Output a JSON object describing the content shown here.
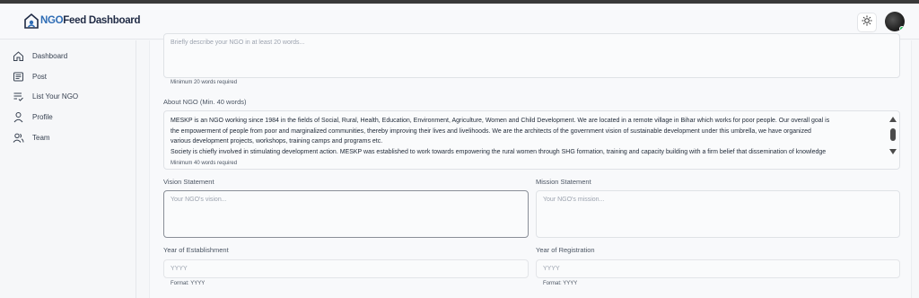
{
  "header": {
    "logo_ngo": "NGO",
    "logo_rest": "Feed Dashboard",
    "theme_icon": "sun-icon",
    "avatar_icon": "user-avatar"
  },
  "sidebar": {
    "items": [
      {
        "label": "Dashboard",
        "icon": "home-icon"
      },
      {
        "label": "Post",
        "icon": "newspaper-icon"
      },
      {
        "label": "List Your NGO",
        "icon": "list-check-icon"
      },
      {
        "label": "Profile",
        "icon": "user-icon"
      },
      {
        "label": "Team",
        "icon": "users-icon"
      }
    ]
  },
  "form": {
    "short_description": {
      "placeholder": "Briefly describe your NGO in at least 20 words...",
      "helper": "Minimum 20 words required"
    },
    "about": {
      "label": "About NGO (Min. 40 words)",
      "lines": [
        "MESKP is an NGO working since 1984 in the fields of Social, Rural, Health, Education, Environment, Agriculture, Women and Child Development. We are located in a remote village in Bihar which works for poor people. Our overall goal is",
        "the empowerment of people from poor and marginalized communities, thereby improving their lives and livelihoods. We are the architects of the government vision of sustainable development under this umbrella, we have organized",
        "various development projects, workshops, training camps and programs etc.",
        "Society is chiefly involved in stimulating development action. MESKP was established to work towards empowering the rural women through SHG formation, training and capacity building with a firm belief that dissemination of knowledge"
      ],
      "helper": "Minimum 40 words required"
    },
    "vision": {
      "label": "Vision Statement",
      "placeholder": "Your NGO's vision..."
    },
    "mission": {
      "label": "Mission Statement",
      "placeholder": "Your NGO's mission..."
    },
    "year_establishment": {
      "label": "Year of Establishment",
      "placeholder": "YYYY",
      "helper": "Format: YYYY"
    },
    "year_registration": {
      "label": "Year of Registration",
      "placeholder": "YYYY",
      "helper": "Format: YYYY"
    }
  }
}
